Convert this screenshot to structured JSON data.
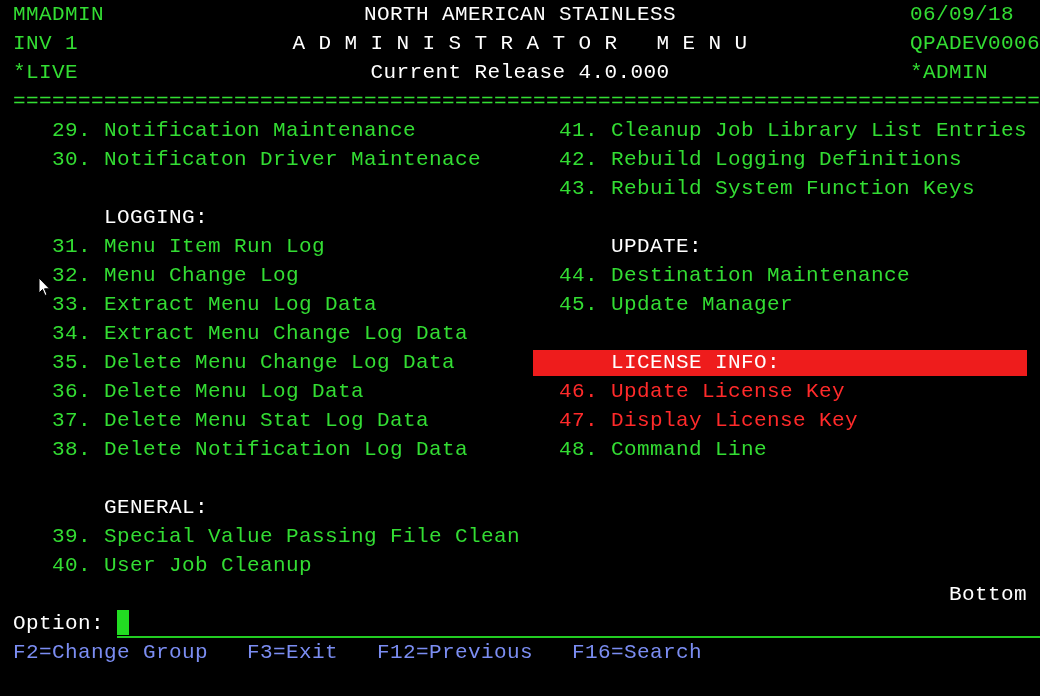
{
  "header": {
    "left": [
      "MMADMIN",
      "INV 1",
      "*LIVE"
    ],
    "center": [
      "NORTH AMERICAN STAINLESS",
      "A D M I N I S T R A T O R   M E N U",
      "Current Release 4.0.000"
    ],
    "right": [
      "06/09/18",
      "QPADEV0006",
      "*ADMIN"
    ],
    "rule": "==============================================================================="
  },
  "columns": [
    {
      "sections": [
        {
          "items": [
            {
              "number": "29.",
              "label": "Notification Maintenance",
              "color": "#33dd33"
            },
            {
              "number": "30.",
              "label": "Notificaton Driver Maintenace",
              "color": "#33dd33"
            }
          ]
        },
        {
          "heading": {
            "text": "LOGGING:",
            "highlighted": false
          },
          "items": [
            {
              "number": "31.",
              "label": "Menu Item Run Log",
              "color": "#33dd33"
            },
            {
              "number": "32.",
              "label": "Menu Change Log",
              "color": "#33dd33"
            },
            {
              "number": "33.",
              "label": "Extract Menu Log Data",
              "color": "#33dd33"
            },
            {
              "number": "34.",
              "label": "Extract Menu Change Log Data",
              "color": "#33dd33"
            },
            {
              "number": "35.",
              "label": "Delete Menu Change Log Data",
              "color": "#33dd33"
            },
            {
              "number": "36.",
              "label": "Delete Menu Log Data",
              "color": "#33dd33"
            },
            {
              "number": "37.",
              "label": "Delete Menu Stat Log Data",
              "color": "#33dd33"
            },
            {
              "number": "38.",
              "label": "Delete Notification Log Data",
              "color": "#33dd33"
            }
          ]
        },
        {
          "heading": {
            "text": "GENERAL:",
            "highlighted": false
          },
          "items": [
            {
              "number": "39.",
              "label": "Special Value Passing File Clean",
              "color": "#33dd33"
            },
            {
              "number": "40.",
              "label": "User Job Cleanup",
              "color": "#33dd33"
            }
          ]
        }
      ]
    },
    {
      "sections": [
        {
          "items": [
            {
              "number": "41.",
              "label": "Cleanup Job Library List Entries",
              "color": "#33dd33"
            },
            {
              "number": "42.",
              "label": "Rebuild Logging Definitions",
              "color": "#33dd33"
            },
            {
              "number": "43.",
              "label": "Rebuild System Function Keys",
              "color": "#33dd33"
            }
          ]
        },
        {
          "heading": {
            "text": "UPDATE:",
            "highlighted": false
          },
          "items": [
            {
              "number": "44.",
              "label": "Destination Maintenance",
              "color": "#33dd33"
            },
            {
              "number": "45.",
              "label": "Update Manager",
              "color": "#33dd33"
            }
          ]
        },
        {
          "heading": {
            "text": "LICENSE INFO:",
            "highlighted": true
          },
          "items": [
            {
              "number": "46.",
              "label": "Update License Key",
              "color": "#ff2a2a"
            },
            {
              "number": "47.",
              "label": "Display License Key",
              "color": "#ff2a2a"
            },
            {
              "number": "48.",
              "label": "Command Line",
              "color": "#33dd33"
            }
          ]
        }
      ]
    }
  ],
  "more": "Bottom",
  "option": {
    "label": "Option:"
  },
  "function_keys": [
    "F2=Change Group",
    "F3=Exit",
    "F12=Previous",
    "F16=Search"
  ]
}
